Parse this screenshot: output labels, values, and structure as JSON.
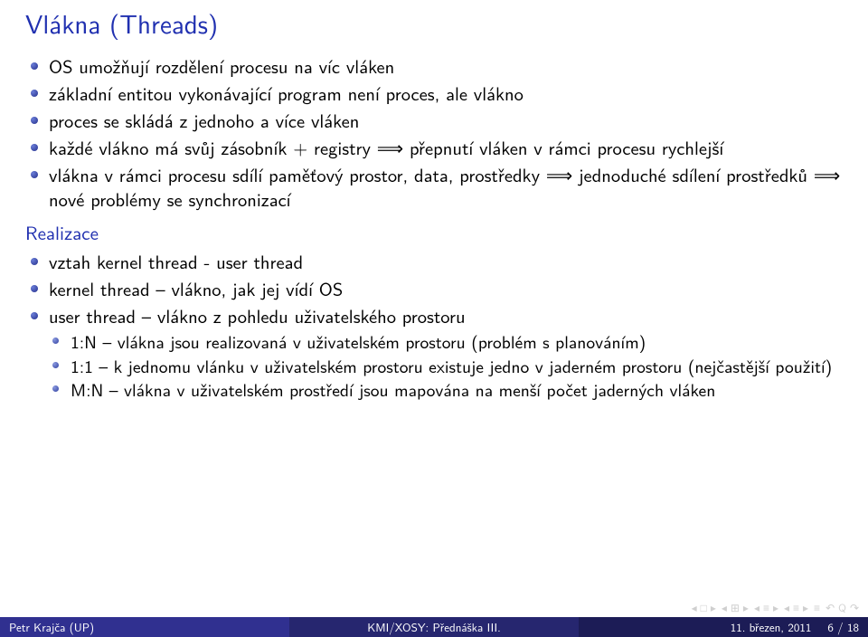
{
  "title": "Vlákna (Threads)",
  "bullets1": [
    "OS umožňují rozdělení procesu na víc vláken",
    "základní entitou vykonávající program není proces, ale vlákno",
    "proces se skládá z jednoho a více vláken",
    "každé vlákno má svůj zásobník + registry ⟹ přepnutí vláken v rámci procesu rychlejší",
    "vlákna v rámci procesu sdílí paměťový prostor, data, prostředky ⟹ jednoduché sdílení prostředků ⟹ nové problémy se synchronizací"
  ],
  "subheading": "Realizace",
  "bullets2": [
    "vztah kernel thread - user thread",
    "kernel thread – vlákno, jak jej vídí OS",
    "user thread – vlákno z pohledu uživatelského prostoru"
  ],
  "bullets3": [
    "1:N – vlákna jsou realizovaná v uživatelském prostoru (problém s planováním)",
    "1:1 – k jednomu vlánku v uživatelském prostoru existuje jedno v jaderném prostoru (nejčastější použití)",
    "M:N – vlákna v uživatelském prostředí jsou mapována na menší počet jaderných vláken"
  ],
  "footer": {
    "left": "Petr Krajča (UP)",
    "mid": "KMI/XOSY: Přednáška III.",
    "right_date": "11. březen, 2011",
    "right_page": "6 / 18"
  },
  "nav": {
    "i1": "◂ □ ▸",
    "i2": "◂ ⊞ ▸",
    "i3": "◂ ≡ ▸",
    "i4": "◂ ≡ ▸",
    "i5": "≡",
    "i6": "↶ Q ↷"
  }
}
